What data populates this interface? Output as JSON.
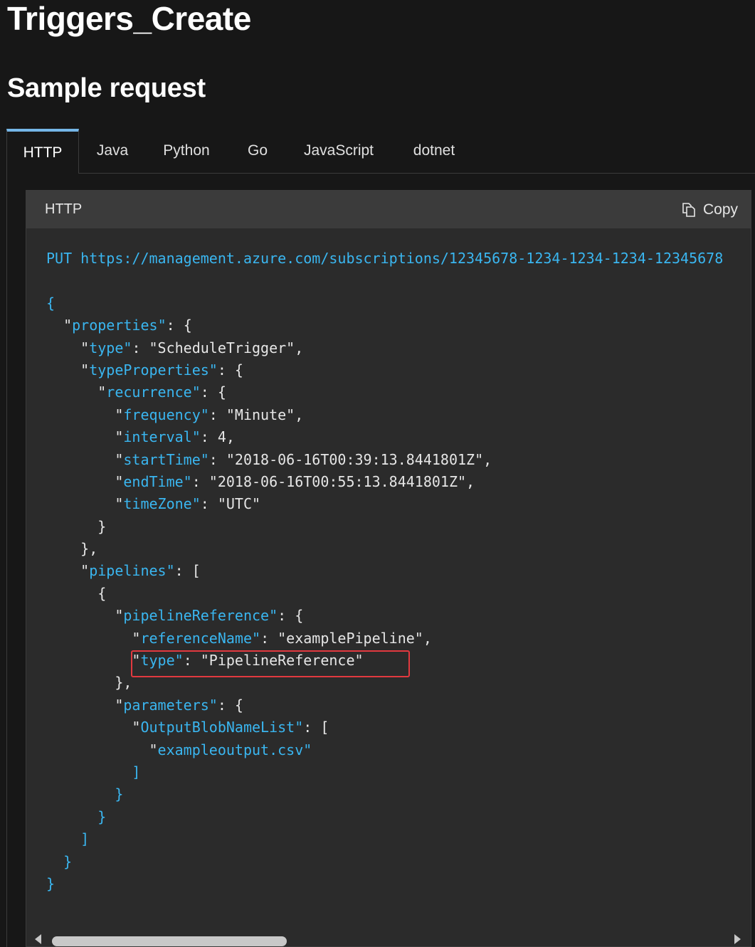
{
  "page": {
    "title": "Triggers_Create",
    "section_title": "Sample request"
  },
  "tabs": [
    {
      "label": "HTTP",
      "active": true
    },
    {
      "label": "Java",
      "active": false
    },
    {
      "label": "Python",
      "active": false
    },
    {
      "label": "Go",
      "active": false
    },
    {
      "label": "JavaScript",
      "active": false
    },
    {
      "label": "dotnet",
      "active": false
    }
  ],
  "code_block": {
    "language_label": "HTTP",
    "copy_label": "Copy",
    "copy_icon": "copy-icon",
    "method": "PUT",
    "url": "https://management.azure.com/subscriptions/12345678-1234-1234-1234-12345678",
    "lines": [
      [],
      [
        {
          "t": "{",
          "c": "k"
        }
      ],
      [
        {
          "t": "  "
        },
        {
          "t": "\"",
          "c": "p"
        },
        {
          "t": "properties",
          "c": "k"
        },
        {
          "t": "\"",
          "c": "k"
        },
        {
          "t": ": {",
          "c": "p"
        }
      ],
      [
        {
          "t": "    "
        },
        {
          "t": "\"",
          "c": "p"
        },
        {
          "t": "type",
          "c": "k"
        },
        {
          "t": "\"",
          "c": "k"
        },
        {
          "t": ": \"ScheduleTrigger\",",
          "c": "p"
        }
      ],
      [
        {
          "t": "    "
        },
        {
          "t": "\"",
          "c": "p"
        },
        {
          "t": "typeProperties",
          "c": "k"
        },
        {
          "t": "\"",
          "c": "k"
        },
        {
          "t": ": {",
          "c": "p"
        }
      ],
      [
        {
          "t": "      "
        },
        {
          "t": "\"",
          "c": "p"
        },
        {
          "t": "recurrence",
          "c": "k"
        },
        {
          "t": "\"",
          "c": "k"
        },
        {
          "t": ": {",
          "c": "p"
        }
      ],
      [
        {
          "t": "        "
        },
        {
          "t": "\"",
          "c": "p"
        },
        {
          "t": "frequency",
          "c": "k"
        },
        {
          "t": "\"",
          "c": "k"
        },
        {
          "t": ": \"Minute\",",
          "c": "p"
        }
      ],
      [
        {
          "t": "        "
        },
        {
          "t": "\"",
          "c": "p"
        },
        {
          "t": "interval",
          "c": "k"
        },
        {
          "t": "\"",
          "c": "k"
        },
        {
          "t": ": 4,",
          "c": "p"
        }
      ],
      [
        {
          "t": "        "
        },
        {
          "t": "\"",
          "c": "p"
        },
        {
          "t": "startTime",
          "c": "k"
        },
        {
          "t": "\"",
          "c": "k"
        },
        {
          "t": ": \"2018-06-16T00:39:13.8441801Z\",",
          "c": "p"
        }
      ],
      [
        {
          "t": "        "
        },
        {
          "t": "\"",
          "c": "p"
        },
        {
          "t": "endTime",
          "c": "k"
        },
        {
          "t": "\"",
          "c": "k"
        },
        {
          "t": ": \"2018-06-16T00:55:13.8441801Z\",",
          "c": "p"
        }
      ],
      [
        {
          "t": "        "
        },
        {
          "t": "\"",
          "c": "p"
        },
        {
          "t": "timeZone",
          "c": "k"
        },
        {
          "t": "\"",
          "c": "k"
        },
        {
          "t": ": \"UTC\"",
          "c": "p"
        }
      ],
      [
        {
          "t": "      }",
          "c": "p"
        }
      ],
      [
        {
          "t": "    },",
          "c": "p"
        }
      ],
      [
        {
          "t": "    "
        },
        {
          "t": "\"",
          "c": "p"
        },
        {
          "t": "pipelines",
          "c": "k"
        },
        {
          "t": "\"",
          "c": "k"
        },
        {
          "t": ": [",
          "c": "p"
        }
      ],
      [
        {
          "t": "      {",
          "c": "p"
        }
      ],
      [
        {
          "t": "        "
        },
        {
          "t": "\"",
          "c": "p"
        },
        {
          "t": "pipelineReference",
          "c": "k"
        },
        {
          "t": "\"",
          "c": "k"
        },
        {
          "t": ": {",
          "c": "p"
        }
      ],
      [
        {
          "t": "          "
        },
        {
          "t": "\"",
          "c": "p"
        },
        {
          "t": "referenceName",
          "c": "k"
        },
        {
          "t": "\"",
          "c": "k"
        },
        {
          "t": ": \"examplePipeline\",",
          "c": "p"
        }
      ],
      [
        {
          "t": "          "
        },
        {
          "t": "\"",
          "c": "p"
        },
        {
          "t": "type",
          "c": "k"
        },
        {
          "t": "\"",
          "c": "k"
        },
        {
          "t": ": \"PipelineReference\"",
          "c": "p"
        }
      ],
      [
        {
          "t": "        },",
          "c": "p"
        }
      ],
      [
        {
          "t": "        "
        },
        {
          "t": "\"",
          "c": "p"
        },
        {
          "t": "parameters",
          "c": "k"
        },
        {
          "t": "\"",
          "c": "k"
        },
        {
          "t": ": {",
          "c": "p"
        }
      ],
      [
        {
          "t": "          "
        },
        {
          "t": "\"",
          "c": "p"
        },
        {
          "t": "OutputBlobNameList",
          "c": "k"
        },
        {
          "t": "\"",
          "c": "k"
        },
        {
          "t": ": [",
          "c": "p"
        }
      ],
      [
        {
          "t": "            "
        },
        {
          "t": "\"",
          "c": "p"
        },
        {
          "t": "exampleoutput.csv",
          "c": "k"
        },
        {
          "t": "\"",
          "c": "k"
        }
      ],
      [
        {
          "t": "          ]",
          "c": "k"
        }
      ],
      [
        {
          "t": "        }",
          "c": "k"
        }
      ],
      [
        {
          "t": "      }",
          "c": "k"
        }
      ],
      [
        {
          "t": "    ]",
          "c": "k"
        }
      ],
      [
        {
          "t": "  }",
          "c": "k"
        }
      ],
      [
        {
          "t": "}",
          "c": "k"
        }
      ]
    ]
  },
  "colors": {
    "background": "#171717",
    "code_background": "#2b2b2b",
    "code_header": "#3b3b3b",
    "keyword": "#3ab6f0",
    "active_tab_accent": "#75b6e7",
    "highlight_border": "#e2393f"
  }
}
